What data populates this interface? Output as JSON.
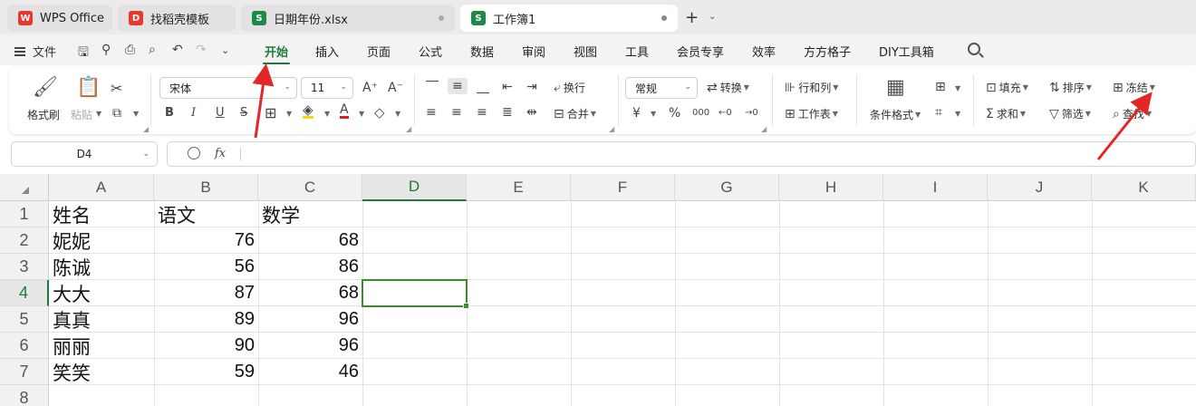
{
  "tabs": [
    {
      "label": "WPS Office",
      "icon": "wps-logo-icon",
      "color": "#e8372d"
    },
    {
      "label": "找稻壳模板",
      "icon": "docer-logo-icon",
      "color": "#e8372d"
    },
    {
      "label": "日期年份.xlsx",
      "icon": "spreadsheet-icon",
      "color": "#1e8a4a"
    },
    {
      "label": "工作簿1",
      "icon": "spreadsheet-icon",
      "color": "#1e8a4a"
    }
  ],
  "menu": {
    "file_label": "文件",
    "tabs": [
      "开始",
      "插入",
      "页面",
      "公式",
      "数据",
      "审阅",
      "视图",
      "工具",
      "会员专享",
      "效率",
      "方方格子",
      "DIY工具箱"
    ],
    "active_tab": "开始"
  },
  "ribbon": {
    "format_painter": "格式刷",
    "paste": "粘贴",
    "font_name": "宋体",
    "font_size": "11",
    "wrap": "换行",
    "merge": "合并",
    "number_format": "常规",
    "convert": "转换",
    "row_col": "行和列",
    "worksheet": "工作表",
    "cond_format": "条件格式",
    "fill": "填充",
    "sort": "排序",
    "freeze": "冻结",
    "sum": "求和",
    "filter": "筛选",
    "find": "查找",
    "font_buttons": [
      "B",
      "I",
      "U",
      "S"
    ],
    "number_buttons": [
      "¥",
      "%",
      "000",
      "←0",
      "→0"
    ]
  },
  "formula_bar": {
    "cell_ref": "D4",
    "fx_label": "fx",
    "content": ""
  },
  "sheet": {
    "columns": [
      "A",
      "B",
      "C",
      "D",
      "E",
      "F",
      "G",
      "H",
      "I",
      "J",
      "K"
    ],
    "selected_column": "D",
    "rows": [
      "1",
      "2",
      "3",
      "4",
      "5",
      "6",
      "7",
      "8"
    ],
    "selected_row": "4",
    "data": [
      [
        "姓名",
        "语文",
        "数学"
      ],
      [
        "妮妮",
        "76",
        "68"
      ],
      [
        "陈诚",
        "56",
        "86"
      ],
      [
        "大大",
        "87",
        "68"
      ],
      [
        "真真",
        "89",
        "96"
      ],
      [
        "丽丽",
        "90",
        "96"
      ],
      [
        "笑笑",
        "59",
        "46"
      ]
    ]
  },
  "colors": {
    "accent": "#1e7a3c",
    "arrow": "#e32727"
  }
}
